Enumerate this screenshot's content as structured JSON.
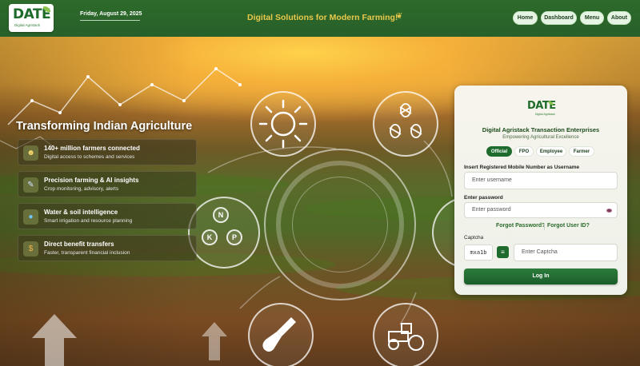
{
  "header": {
    "logo_text": "DATE",
    "logo_subtext": "Digital Agristack",
    "date": "Friday, August 29, 2025",
    "tagline": "Digital Solutions for Modern Farming!",
    "tagline_icon": "seedling-icon",
    "nav": [
      {
        "label": "Home"
      },
      {
        "label": "Dashboard"
      },
      {
        "label": "Menu"
      },
      {
        "label": "About"
      }
    ]
  },
  "hero": {
    "title": "Transforming Indian Agriculture",
    "features": [
      {
        "icon": "farmer-icon",
        "title": "140+ million farmers connected",
        "desc": "Digital access to schemes and services"
      },
      {
        "icon": "ai-icon",
        "title": "Precision farming & AI insights",
        "desc": "Crop monitoring, advisory, alerts"
      },
      {
        "icon": "water-drop-icon",
        "title": "Water & soil intelligence",
        "desc": "Smart irrigation and resource planning"
      },
      {
        "icon": "money-bag-icon",
        "title": "Direct benefit transfers",
        "desc": "Faster, transparent financial inclusion"
      }
    ],
    "npk": [
      "N",
      "K",
      "P"
    ]
  },
  "login": {
    "logo_text": "DATE",
    "logo_subtext": "Digital Agristack",
    "title": "Digital Agristack Transaction Enterprises",
    "subtitle": "Empowering Agricultural Excellence",
    "tabs": [
      {
        "label": "Official",
        "active": true
      },
      {
        "label": "FPO",
        "active": false
      },
      {
        "label": "Employee",
        "active": false
      },
      {
        "label": "Farmer",
        "active": false
      }
    ],
    "username_label": "Insert Registered Mobile Number as Username",
    "username_placeholder": "Enter username",
    "password_label": "Enter password",
    "password_placeholder": "Enter password",
    "forgot_password": "Forgot Password?",
    "forgot_user_id": "Forgot User ID?",
    "captcha_label": "Captcha",
    "captcha_value": "mxa1b",
    "captcha_placeholder": "Enter Captcha",
    "login_button": "Log In"
  },
  "colors": {
    "header_green": "#2e6a2a",
    "accent_gold": "#e8c84a",
    "primary_green": "#1f6b2e"
  }
}
